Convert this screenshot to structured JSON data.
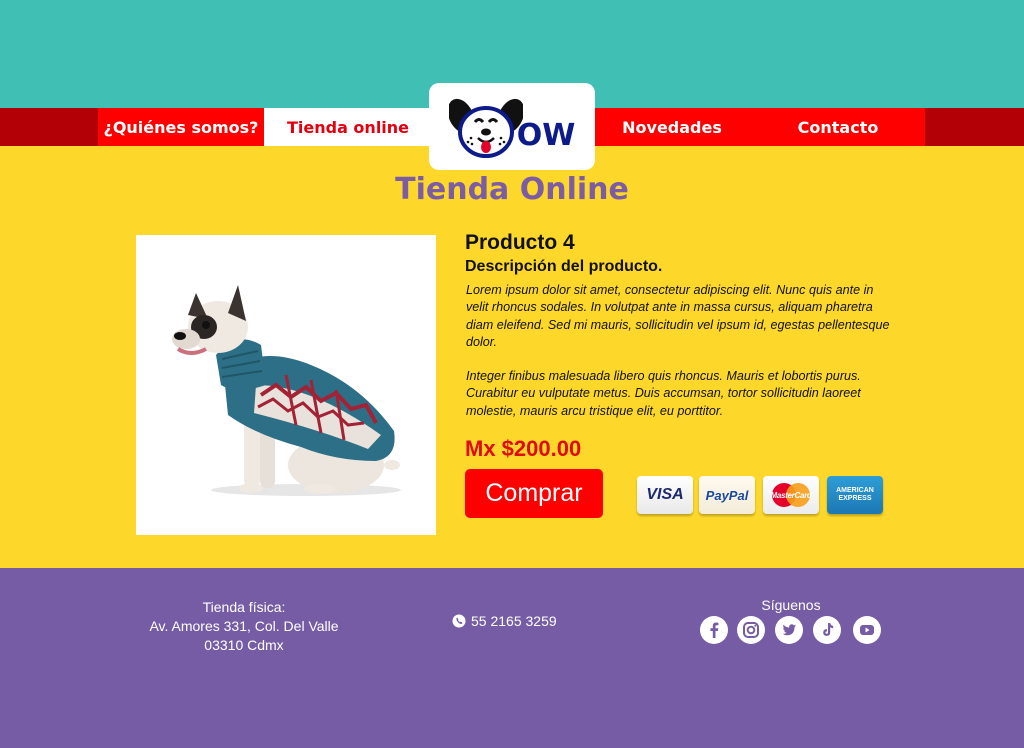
{
  "nav": {
    "items": [
      {
        "label": "¿Quiénes somos?"
      },
      {
        "label": "Tienda online"
      },
      {
        "label": "Novedades"
      },
      {
        "label": "Contacto"
      }
    ],
    "logo_text": "OW",
    "logo_icon": "dog-face-icon"
  },
  "page": {
    "title": "Tienda Online"
  },
  "product": {
    "name": "Producto 4",
    "subtitle": "Descripción del producto.",
    "description": [
      "Lorem ipsum dolor sit amet, consectetur adipiscing elit. Nunc quis ante in velit rhoncus sodales. In volutpat ante in massa cursus, aliquam pharetra diam eleifend. Sed mi mauris, sollicitudin vel ipsum id, egestas pellentesque dolor.",
      "Integer finibus malesuada libero quis rhoncus. Mauris et lobortis purus. Curabitur eu vulputate metus. Duis accumsan, tortor sollicitudin laoreet molestie, mauris arcu tristique elit, eu porttitor."
    ],
    "price": "Mx $200.00",
    "buy_label": "Comprar",
    "image_icon": "dog-in-sweater-image"
  },
  "payments": [
    {
      "label": "VISA",
      "icon": "visa-card-icon"
    },
    {
      "label": "PayPal",
      "icon": "paypal-card-icon"
    },
    {
      "label": "MasterCard",
      "icon": "mastercard-card-icon"
    },
    {
      "label": "AMERICAN EXPRESS",
      "icon": "amex-card-icon"
    }
  ],
  "footer": {
    "address_lines": [
      "Tienda física:",
      "Av. Amores 331, Col. Del Valle",
      "03310 Cdmx"
    ],
    "phone": "55 2165 3259",
    "follow_label": "Síguenos",
    "social": [
      "facebook-icon",
      "instagram-icon",
      "twitter-icon",
      "tiktok-icon",
      "youtube-icon"
    ]
  },
  "colors": {
    "teal": "#40bfb5",
    "red": "#fe0000",
    "dark_red": "#b30006",
    "yellow": "#fdd82b",
    "purple": "#765ca5"
  }
}
